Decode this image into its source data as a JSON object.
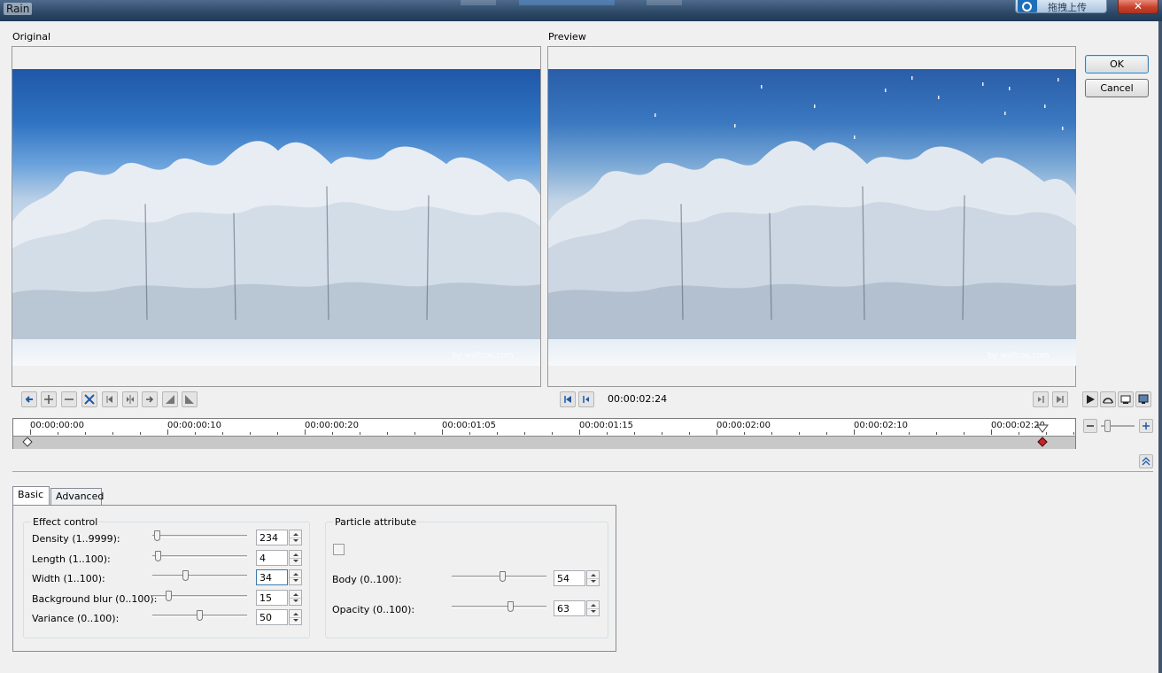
{
  "window": {
    "title": "Rain",
    "upload_label": "拖拽上传",
    "close_glyph": "✕"
  },
  "panes": {
    "original_label": "Original",
    "preview_label": "Preview",
    "watermark": "by  wallcoo.com"
  },
  "buttons": {
    "ok": "OK",
    "cancel": "Cancel"
  },
  "playback": {
    "timecode": "00:00:02:24"
  },
  "timeline": {
    "labels": [
      "00:00:00:00",
      "00:00:00:10",
      "00:00:00:20",
      "00:00:01:05",
      "00:00:01:15",
      "00:00:02:00",
      "00:00:02:10",
      "00:00:02:20"
    ]
  },
  "tabs": {
    "basic": "Basic",
    "advanced": "Advanced"
  },
  "effect_control": {
    "title": "Effect control",
    "rows": [
      {
        "label": "Density (1..9999):",
        "value": "234",
        "fraction": 0.02
      },
      {
        "label": "Length (1..100):",
        "value": "4",
        "fraction": 0.03
      },
      {
        "label": "Width (1..100):",
        "value": "34",
        "fraction": 0.34
      },
      {
        "label": "Background blur (0..100):",
        "value": "15",
        "fraction": 0.15
      },
      {
        "label": "Variance (0..100):",
        "value": "50",
        "fraction": 0.5
      }
    ]
  },
  "particle_attribute": {
    "title": "Particle attribute",
    "checkbox_checked": false,
    "rows": [
      {
        "label": "Body (0..100):",
        "value": "54",
        "fraction": 0.54
      },
      {
        "label": "Opacity (0..100):",
        "value": "63",
        "fraction": 0.63
      }
    ]
  },
  "icons": {
    "toolbar_left": [
      "go-to-start-icon",
      "add-keyframe-icon",
      "remove-keyframe-icon",
      "reverse-keyframes-icon",
      "previous-keyframe-icon",
      "keyframe-split-icon",
      "next-keyframe-icon",
      "fade-in-icon",
      "fade-out-icon"
    ],
    "preview_transport": [
      "jump-to-start-icon",
      "step-back-icon"
    ],
    "right_transport": [
      "step-forward-icon",
      "jump-to-end-icon",
      "play-icon",
      "loop-icon",
      "preview-device-icon",
      "monitor-icon"
    ]
  },
  "colors": {
    "keyframe_active": "#c0272d",
    "default_button_border": "#3c7fb1"
  }
}
